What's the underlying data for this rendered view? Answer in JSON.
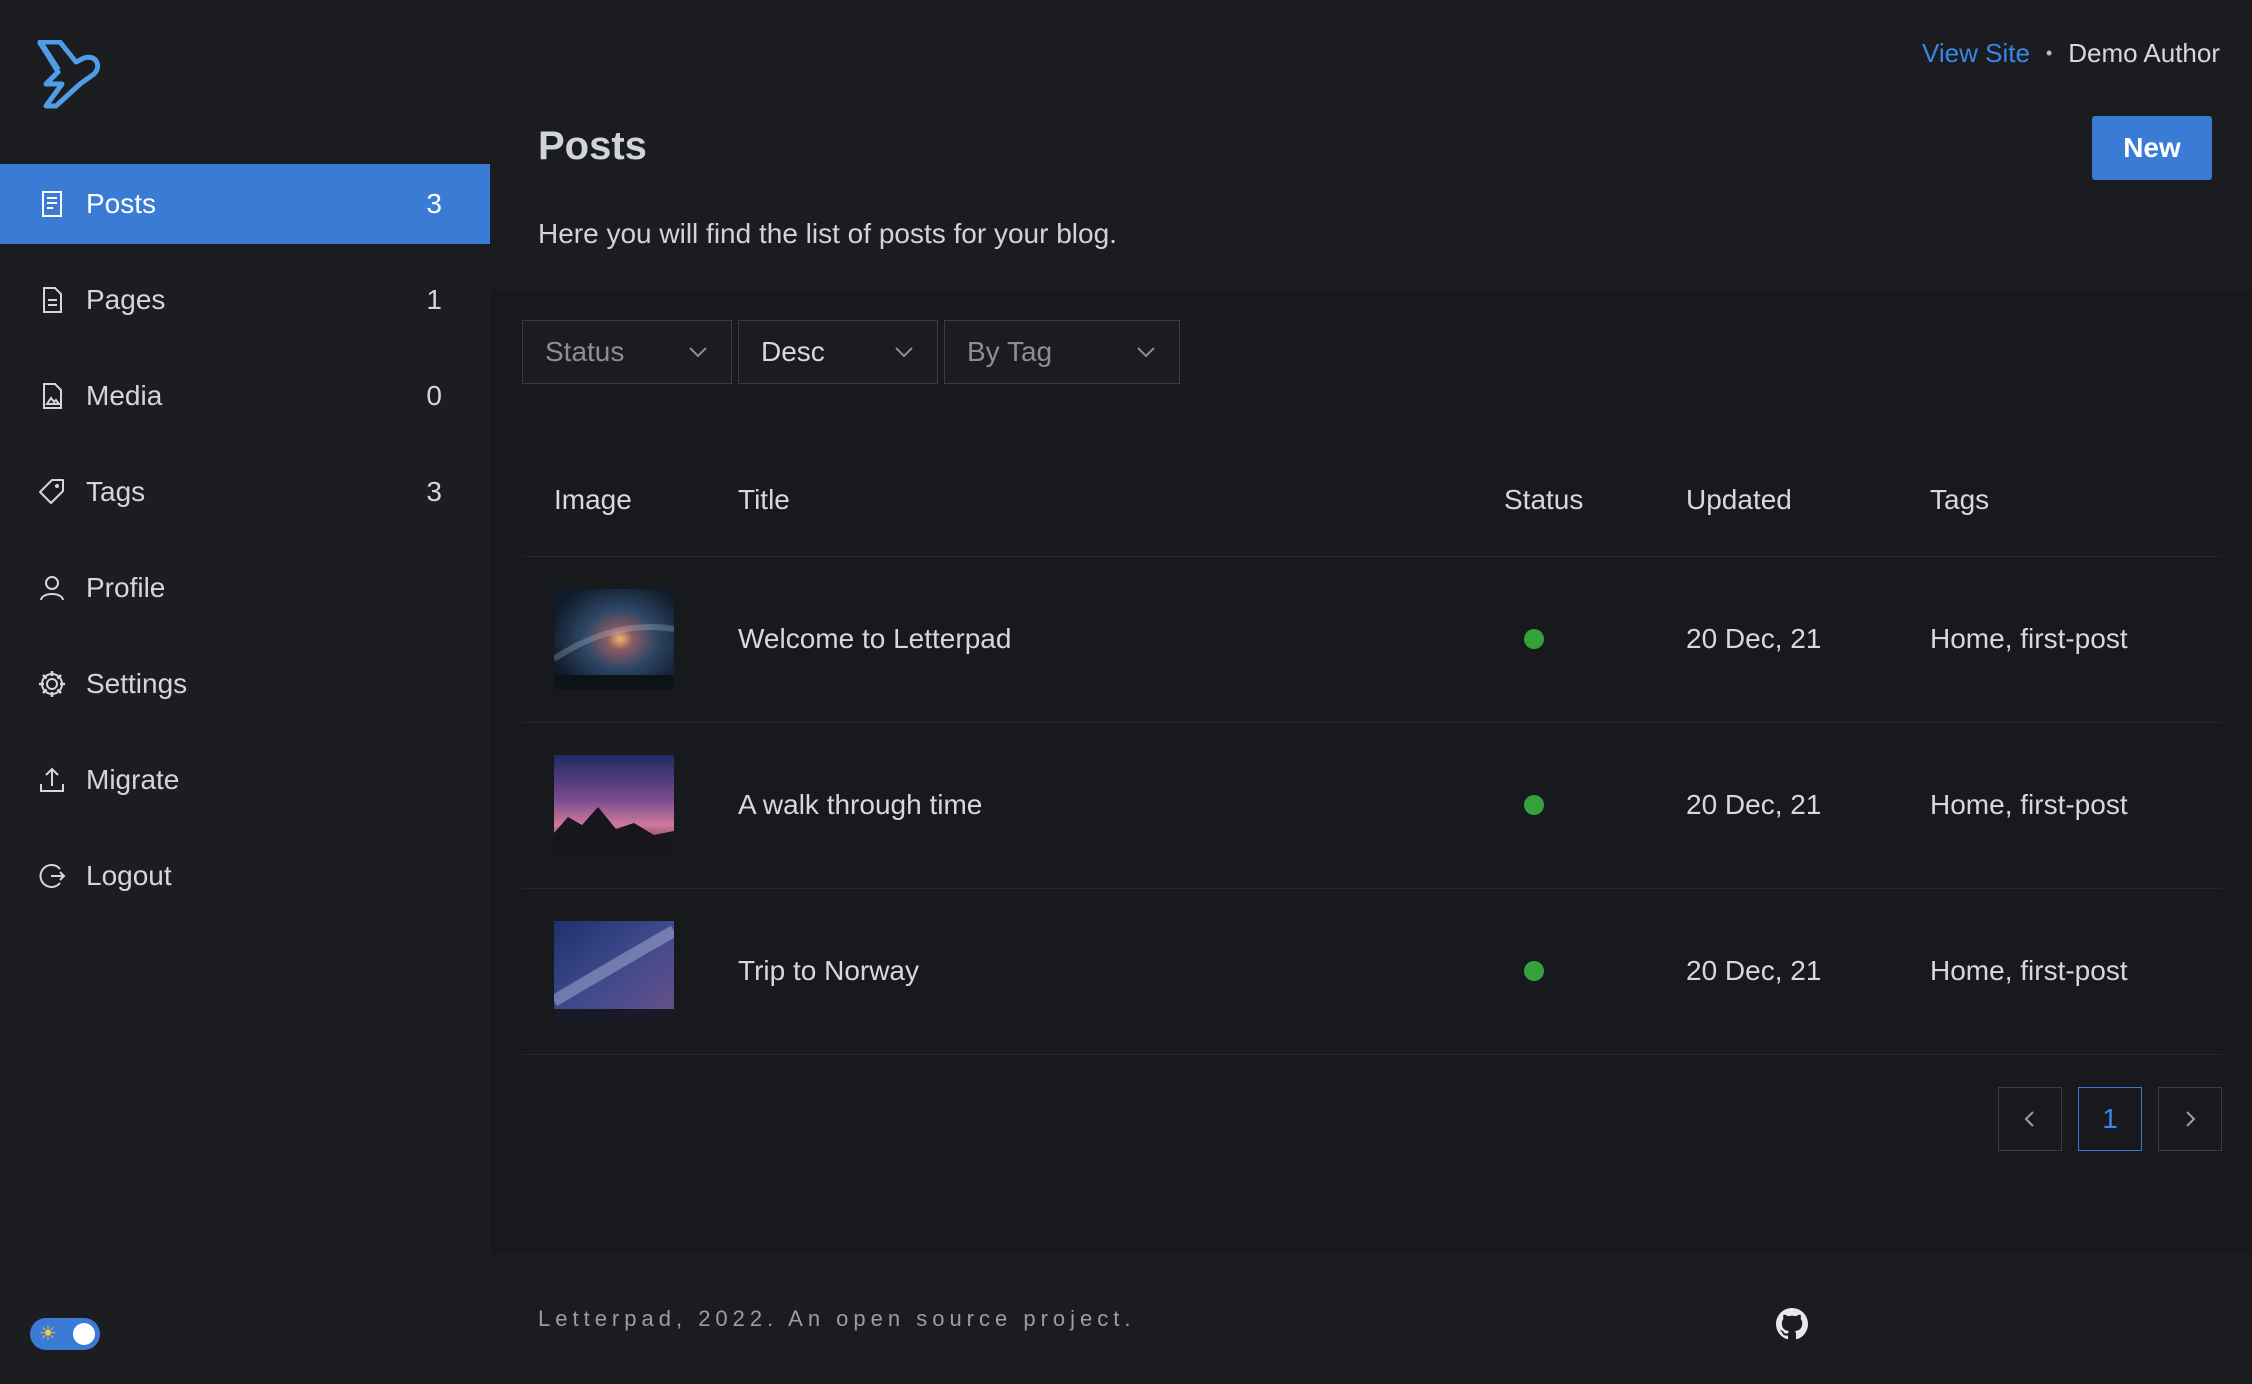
{
  "sidebar": {
    "items": [
      {
        "label": "Posts",
        "count": "3",
        "icon": "posts-icon",
        "active": true
      },
      {
        "label": "Pages",
        "count": "1",
        "icon": "page-icon"
      },
      {
        "label": "Media",
        "count": "0",
        "icon": "media-icon"
      },
      {
        "label": "Tags",
        "count": "3",
        "icon": "tag-icon"
      },
      {
        "label": "Profile",
        "count": "",
        "icon": "user-icon"
      },
      {
        "label": "Settings",
        "count": "",
        "icon": "gear-icon"
      },
      {
        "label": "Migrate",
        "count": "",
        "icon": "upload-icon"
      },
      {
        "label": "Logout",
        "count": "",
        "icon": "logout-icon"
      }
    ],
    "theme_toggle_icon": "☀"
  },
  "topbar": {
    "view_site": "View Site",
    "separator": "•",
    "author": "Demo Author"
  },
  "header": {
    "title": "Posts",
    "description": "Here you will find the list of posts for your blog.",
    "new_button": "New"
  },
  "filters": {
    "status": "Status",
    "order": "Desc",
    "tag": "By Tag"
  },
  "table": {
    "headers": [
      "Image",
      "Title",
      "Status",
      "Updated",
      "Tags"
    ],
    "rows": [
      {
        "title": "Welcome to Letterpad",
        "status": "published",
        "updated": "20 Dec, 21",
        "tags": "Home, first-post"
      },
      {
        "title": "A walk through time",
        "status": "published",
        "updated": "20 Dec, 21",
        "tags": "Home, first-post"
      },
      {
        "title": "Trip to Norway",
        "status": "published",
        "updated": "20 Dec, 21",
        "tags": "Home, first-post"
      }
    ]
  },
  "pagination": {
    "prev": "<",
    "current": "1",
    "next": ">"
  },
  "footer": {
    "text": "Letterpad, 2022. An open source project."
  },
  "colors": {
    "accent": "#3a7bd5",
    "link": "#3a86e8",
    "published": "#36a03b",
    "background": "#18191c"
  }
}
